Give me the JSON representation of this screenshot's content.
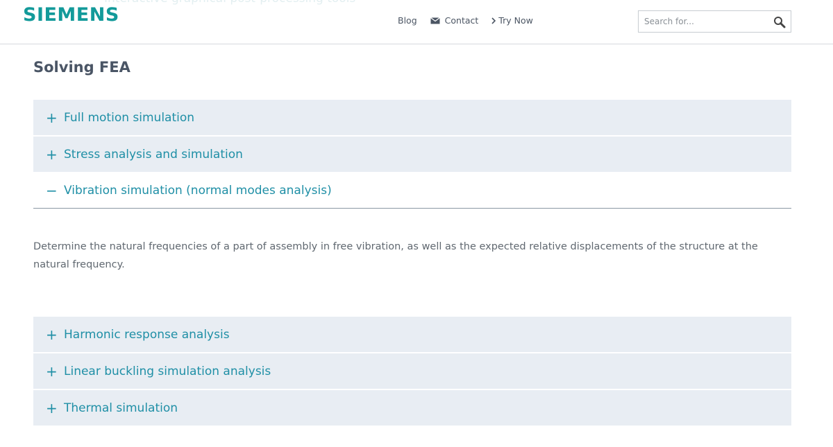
{
  "header": {
    "ghost_text": "Interactive graphical post-processing tools",
    "logo": "SIEMENS",
    "nav": [
      {
        "label": "Blog",
        "icon": ""
      },
      {
        "label": "Contact",
        "icon": "envelope-icon"
      },
      {
        "label": "Try Now",
        "icon": "chevron-right-icon"
      }
    ],
    "search_placeholder": "Search for...",
    "search_icon": "magnifier-icon"
  },
  "page_title": "Solving FEA",
  "accordion": {
    "top": [
      {
        "sign": "+",
        "label": "Full motion simulation"
      },
      {
        "sign": "+",
        "label": "Stress analysis and simulation"
      },
      {
        "sign": "−",
        "label": "Vibration simulation (normal modes analysis)"
      }
    ],
    "open_body": "Determine the natural frequencies of a part of assembly in free vibration, as well as the expected relative displacements of the structure at the natural frequency.",
    "bottom": [
      {
        "sign": "+",
        "label": "Harmonic response analysis"
      },
      {
        "sign": "+",
        "label": "Linear buckling simulation analysis"
      },
      {
        "sign": "+",
        "label": "Thermal simulation"
      }
    ]
  },
  "colors": {
    "accent": "#1f8fa6",
    "logo": "#139a9a",
    "panel": "#e8edf3"
  }
}
